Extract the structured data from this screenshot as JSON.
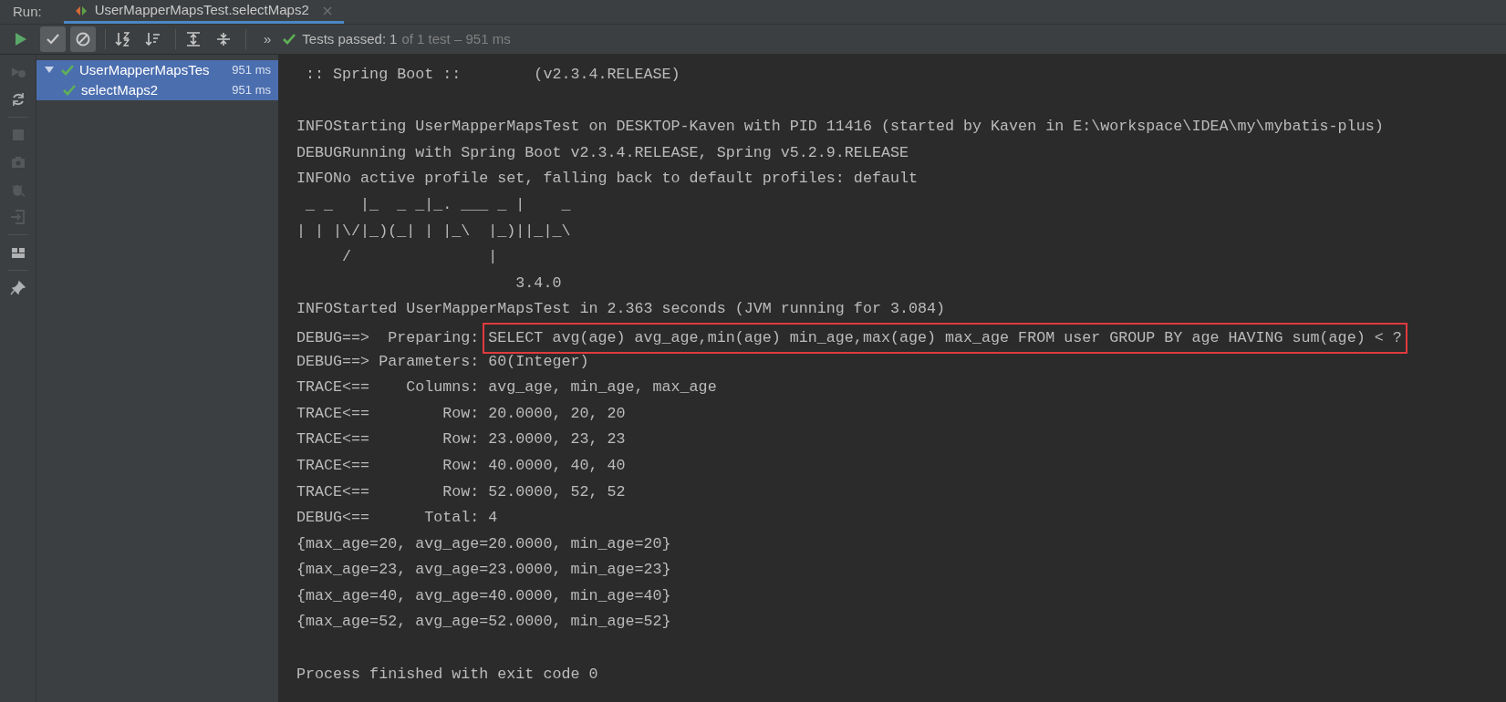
{
  "run_bar": {
    "label": "Run:",
    "tab": {
      "title": "UserMapperMapsTest.selectMaps2",
      "selected": true
    }
  },
  "toolbar": {
    "buttons": [
      {
        "kind": "show-passed",
        "selected": true
      },
      {
        "kind": "show-ignored",
        "selected": true
      },
      {
        "kind": "sort-alpha",
        "selected": false
      },
      {
        "kind": "sort-duration",
        "selected": false
      },
      {
        "kind": "expand-all",
        "selected": false
      },
      {
        "kind": "collapse-all",
        "selected": false
      }
    ],
    "more": "»",
    "status": {
      "passed": true,
      "label": "Tests passed:",
      "count": "1",
      "detail": "of 1 test – 951 ms"
    }
  },
  "gutter": [
    {
      "kind": "rerun",
      "disabled": false
    },
    {
      "kind": "rerun-failed",
      "disabled": true
    },
    {
      "kind": "auto-test",
      "disabled": false
    },
    {
      "kind": "stop",
      "disabled": true
    },
    {
      "kind": "camera",
      "disabled": true
    },
    {
      "kind": "bug",
      "disabled": true
    },
    {
      "kind": "import",
      "disabled": true
    },
    {
      "kind": "layout",
      "disabled": false
    },
    {
      "kind": "pin",
      "disabled": false
    }
  ],
  "tree": [
    {
      "name": "UserMapperMapsTes",
      "time": "951 ms",
      "passed": true,
      "expanded": true,
      "selected": true,
      "children": [
        {
          "name": "selectMaps2",
          "time": "951 ms",
          "passed": true,
          "selected": true
        }
      ]
    }
  ],
  "console": [
    {
      "kind": "text",
      "text": " :: Spring Boot ::        (v2.3.4.RELEASE)"
    },
    {
      "kind": "blank"
    },
    {
      "kind": "text",
      "text": "INFOStarting UserMapperMapsTest on DESKTOP-Kaven with PID 11416 (started by Kaven in E:\\workspace\\IDEA\\my\\mybatis-plus)"
    },
    {
      "kind": "text",
      "text": "DEBUGRunning with Spring Boot v2.3.4.RELEASE, Spring v5.2.9.RELEASE"
    },
    {
      "kind": "text",
      "text": "INFONo active profile set, falling back to default profiles: default"
    },
    {
      "kind": "text",
      "text": " _ _   |_  _ _|_. ___ _ |    _"
    },
    {
      "kind": "text",
      "text": "| | |\\/|_)(_| | |_\\  |_)||_|_\\"
    },
    {
      "kind": "text",
      "text": "     /               |"
    },
    {
      "kind": "text",
      "text": "                        3.4.0"
    },
    {
      "kind": "text",
      "text": "INFOStarted UserMapperMapsTest in 2.363 seconds (JVM running for 3.084)"
    },
    {
      "kind": "boxed",
      "text": "DEBUG==>  Preparing: ",
      "boxed": "SELECT avg(age) avg_age,min(age) min_age,max(age) max_age FROM user GROUP BY age HAVING sum(age) < ?"
    },
    {
      "kind": "text",
      "text": "DEBUG==> Parameters: 60(Integer)"
    },
    {
      "kind": "text",
      "text": "TRACE<==    Columns: avg_age, min_age, max_age"
    },
    {
      "kind": "text",
      "text": "TRACE<==        Row: 20.0000, 20, 20"
    },
    {
      "kind": "text",
      "text": "TRACE<==        Row: 23.0000, 23, 23"
    },
    {
      "kind": "text",
      "text": "TRACE<==        Row: 40.0000, 40, 40"
    },
    {
      "kind": "text",
      "text": "TRACE<==        Row: 52.0000, 52, 52"
    },
    {
      "kind": "text",
      "text": "DEBUG<==      Total: 4"
    },
    {
      "kind": "text",
      "text": "{max_age=20, avg_age=20.0000, min_age=20}"
    },
    {
      "kind": "text",
      "text": "{max_age=23, avg_age=23.0000, min_age=23}"
    },
    {
      "kind": "text",
      "text": "{max_age=40, avg_age=40.0000, min_age=40}"
    },
    {
      "kind": "text",
      "text": "{max_age=52, avg_age=52.0000, min_age=52}"
    },
    {
      "kind": "blank"
    },
    {
      "kind": "text",
      "text": "Process finished with exit code 0"
    }
  ]
}
